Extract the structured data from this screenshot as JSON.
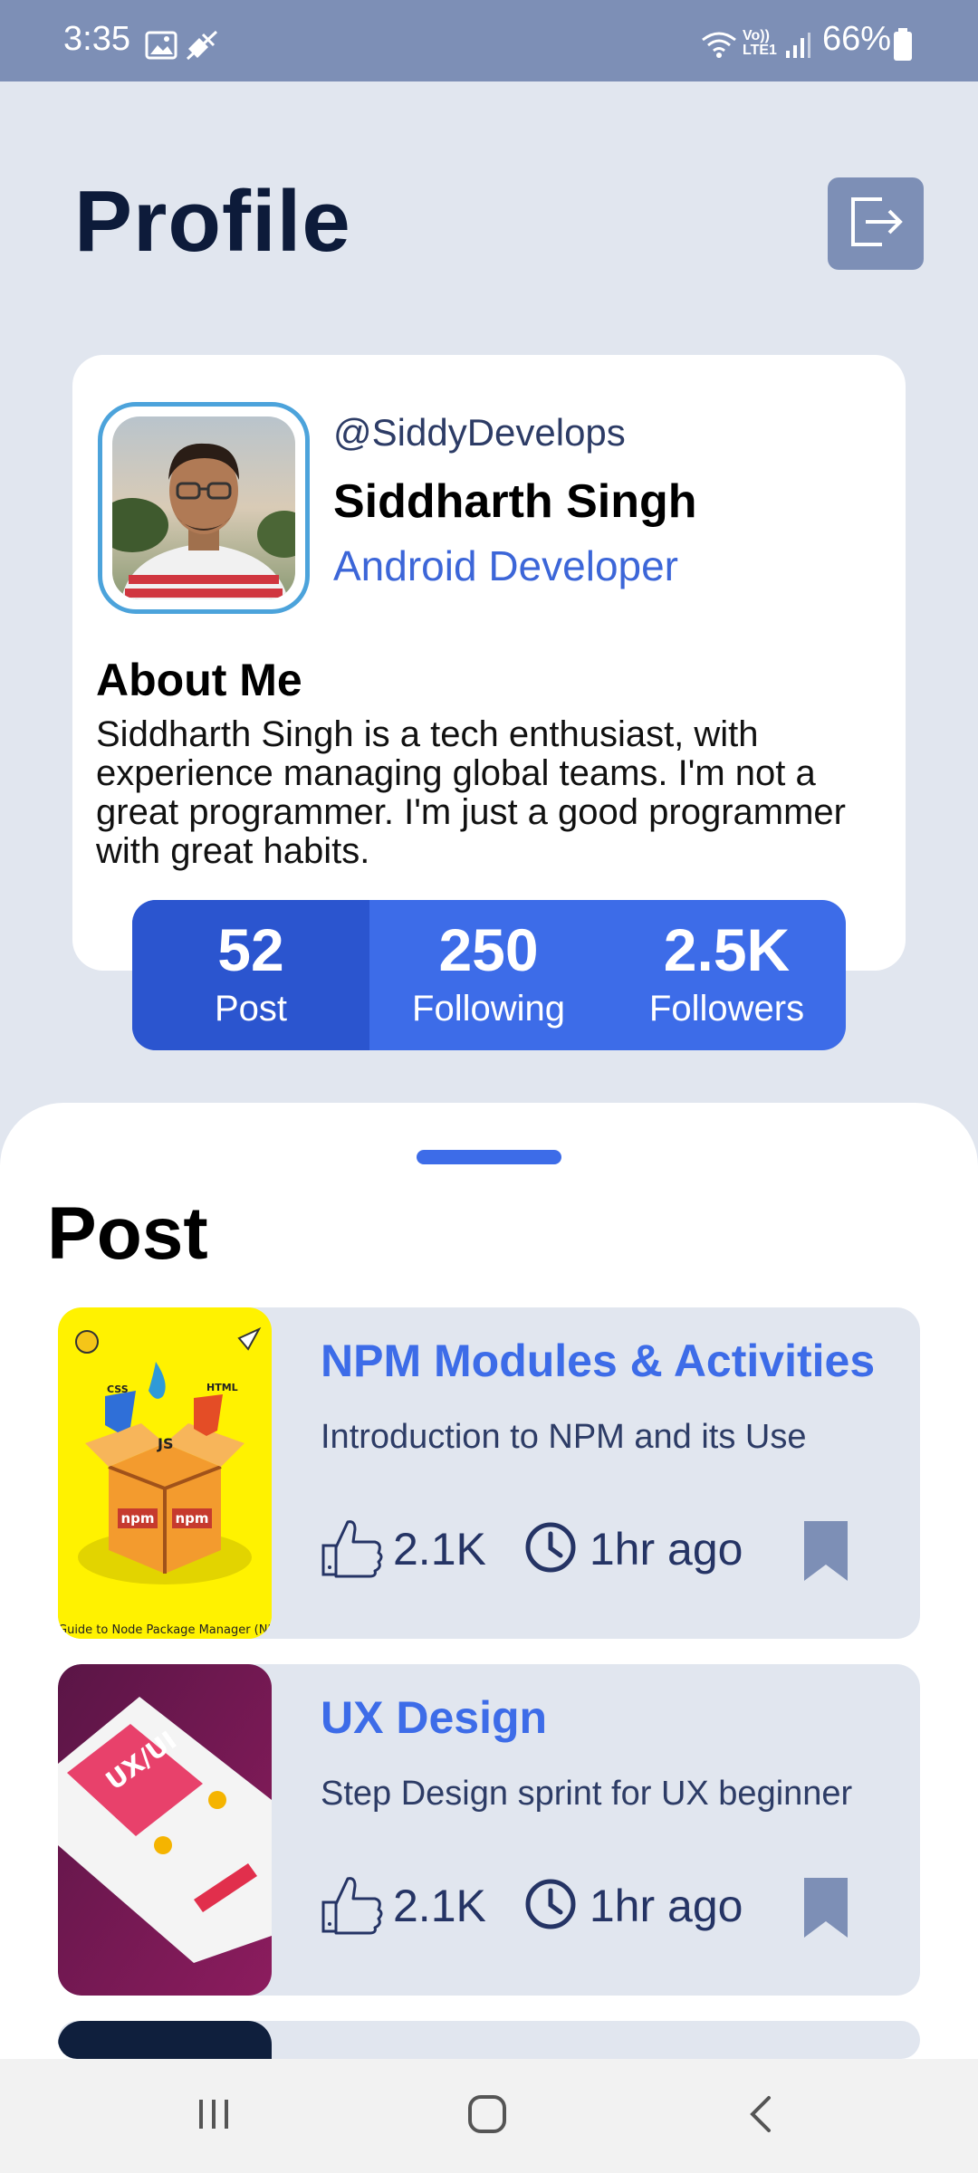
{
  "status_bar": {
    "time": "3:35",
    "battery": "66%",
    "icons": [
      "gallery-icon",
      "mute-icon",
      "wifi-icon",
      "volte-icon",
      "signal-icon",
      "battery-icon"
    ]
  },
  "header": {
    "title": "Profile",
    "logout_icon": "logout-icon"
  },
  "profile": {
    "handle": "@SiddyDevelops",
    "name": "Siddharth Singh",
    "role": "Android Developer",
    "about_title": "About Me",
    "about_text": "Siddharth Singh is a tech enthusiast, with experience managing global teams. I'm not a great programmer. I'm just a good programmer with great habits."
  },
  "stats": [
    {
      "value": "52",
      "label": "Post"
    },
    {
      "value": "250",
      "label": "Following"
    },
    {
      "value": "2.5K",
      "label": "Followers"
    }
  ],
  "posts_section": {
    "title": "Post",
    "items": [
      {
        "title": "NPM Modules & Activities",
        "subtitle": "Introduction to NPM and its Use",
        "likes": "2.1K",
        "time": "1hr ago",
        "thumb_caption": "Guide to Node Package Manager (NPM) i",
        "thumb_labels": [
          "npm",
          "npm",
          "JS",
          "HTML",
          "CSS"
        ]
      },
      {
        "title": "UX Design",
        "subtitle": "Step Design sprint for UX beginner",
        "likes": "2.1K",
        "time": "1hr ago",
        "thumb_caption": "UX/UI"
      }
    ]
  },
  "colors": {
    "accent": "#3d6ce8",
    "status_bar": "#7d8fb6",
    "background": "#e1e6ef",
    "title": "#0d1b3a"
  },
  "navigation": [
    "recents-icon",
    "home-icon",
    "back-icon"
  ]
}
